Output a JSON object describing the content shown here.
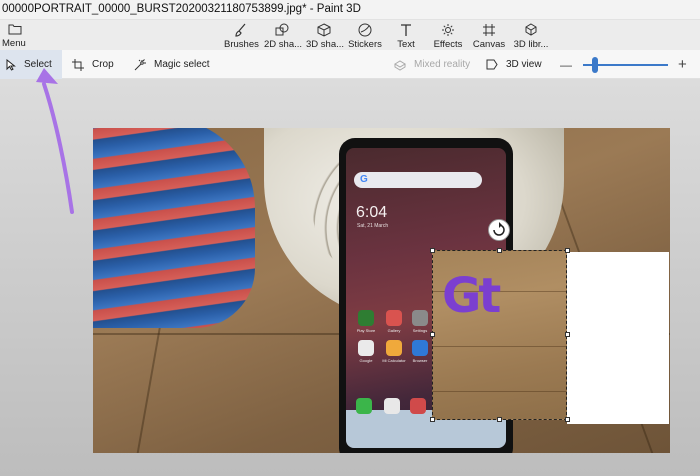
{
  "window": {
    "title": "00000PORTRAIT_00000_BURST20200321180753899.jpg* - Paint 3D"
  },
  "ribbon": {
    "menu_label": "Menu",
    "tools": [
      {
        "label": "Brushes",
        "icon": "brush-icon"
      },
      {
        "label": "2D sha...",
        "icon": "2d-shapes-icon"
      },
      {
        "label": "3D sha...",
        "icon": "3d-shapes-icon"
      },
      {
        "label": "Stickers",
        "icon": "stickers-icon"
      },
      {
        "label": "Text",
        "icon": "text-icon"
      },
      {
        "label": "Effects",
        "icon": "effects-icon"
      },
      {
        "label": "Canvas",
        "icon": "canvas-icon"
      },
      {
        "label": "3D libr...",
        "icon": "3d-library-icon"
      }
    ]
  },
  "toolbar": {
    "select_label": "Select",
    "crop_label": "Crop",
    "magic_select_label": "Magic select",
    "mixed_reality_label": "Mixed reality",
    "view_3d_label": "3D view",
    "zoom_out_symbol": "—",
    "zoom_in_symbol": "+",
    "zoom_level_fraction": 0.12
  },
  "canvas_content": {
    "phone_time": "6:04",
    "phone_date": "Sat, 21 March",
    "phone_search": "G",
    "apps": [
      "Play Store",
      "Gallery",
      "Settings",
      "Google",
      "Mi Calculator",
      "Browser"
    ],
    "logo_text": "Gt"
  },
  "colors": {
    "accent": "#3b79c9",
    "annotation_arrow": "#a873e6",
    "logo": "#7b3fd0"
  }
}
